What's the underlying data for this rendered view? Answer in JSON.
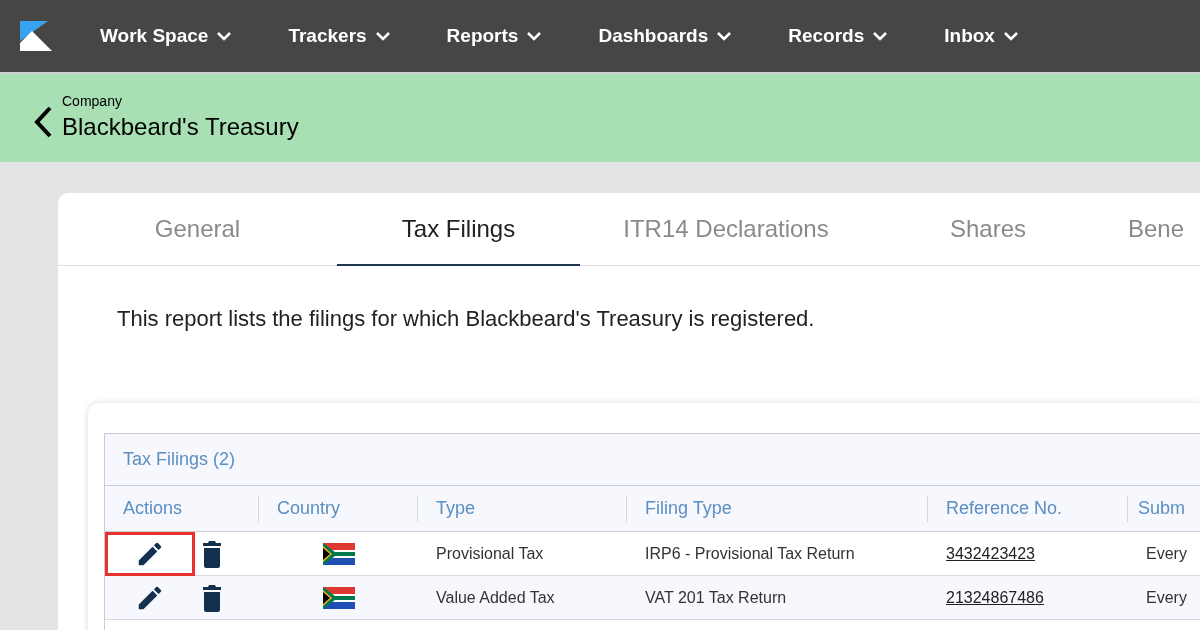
{
  "nav": {
    "items": [
      {
        "label": "Work Space"
      },
      {
        "label": "Trackers"
      },
      {
        "label": "Reports"
      },
      {
        "label": "Dashboards"
      },
      {
        "label": "Records"
      },
      {
        "label": "Inbox"
      }
    ]
  },
  "header": {
    "subtitle": "Company",
    "title": "Blackbeard's Treasury"
  },
  "tabs": [
    {
      "label": "General",
      "selected": false
    },
    {
      "label": "Tax Filings",
      "selected": true
    },
    {
      "label": "ITR14 Declarations",
      "selected": false
    },
    {
      "label": "Shares",
      "selected": false
    },
    {
      "label": "Bene",
      "selected": false
    }
  ],
  "description": "This report lists the filings for which Blackbeard's Treasury is registered.",
  "table": {
    "title": "Tax Filings (2)",
    "columns": [
      "Actions",
      "Country",
      "Type",
      "Filing Type",
      "Reference No.",
      "Subm"
    ],
    "rows": [
      {
        "edit_highlighted": true,
        "type": "Provisional Tax",
        "filing_type": "IRP6 - Provisional Tax Return",
        "reference": "3432423423",
        "column_6": "Every"
      },
      {
        "edit_highlighted": false,
        "type": "Value Added Tax",
        "filing_type": "VAT 201 Tax Return",
        "reference": "21324867486",
        "column_6": "Every"
      }
    ]
  }
}
